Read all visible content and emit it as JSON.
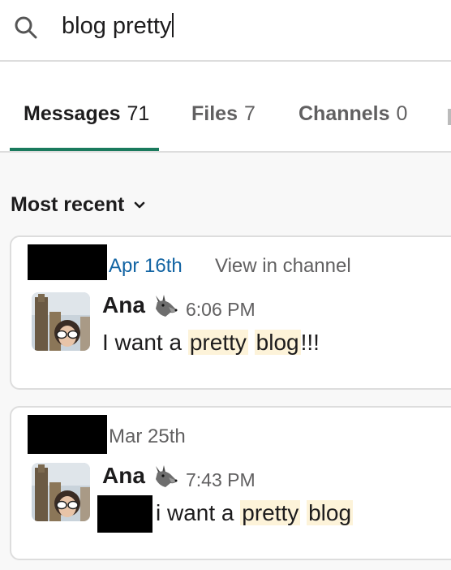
{
  "search": {
    "query": "blog pretty"
  },
  "tabs": [
    {
      "label": "Messages",
      "count": "71"
    },
    {
      "label": "Files",
      "count": "7"
    },
    {
      "label": "Channels",
      "count": "0"
    }
  ],
  "sort": {
    "label": "Most recent"
  },
  "results": [
    {
      "date": "Apr 16th",
      "view_link": "View in channel",
      "author": "Ana",
      "time": "6:06 PM",
      "message": {
        "pre": "I want a ",
        "hl1": "pretty",
        "mid": " ",
        "hl2": "blog",
        "post": "!!!"
      }
    },
    {
      "date": "Mar 25th",
      "author": "Ana",
      "time": "7:43 PM",
      "message": {
        "pre": "i want a ",
        "hl1": "pretty",
        "mid": " ",
        "hl2": "blog",
        "post": ""
      }
    }
  ],
  "colors": {
    "accent": "#1a7a5d",
    "link": "#1264a3",
    "highlight": "#fdf3d9",
    "muted": "#616061"
  },
  "icons": [
    "search-icon",
    "chevron-down-icon",
    "wolf-emoji-icon",
    "avatar"
  ]
}
